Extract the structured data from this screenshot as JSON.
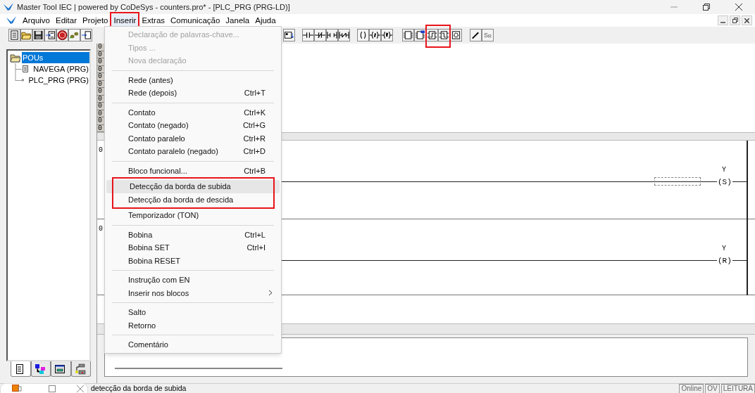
{
  "window": {
    "title": "Master Tool IEC | powered by CoDeSys - counters.pro* - [PLC_PRG (PRG-LD)]"
  },
  "menu_bar": [
    {
      "label": "Arquivo",
      "selected": false,
      "highlighted": false
    },
    {
      "label": "Editar",
      "selected": false,
      "highlighted": false
    },
    {
      "label": "Projeto",
      "selected": false,
      "highlighted": false
    },
    {
      "label": "Inserir",
      "selected": true,
      "highlighted": true
    },
    {
      "label": "Extras",
      "selected": false,
      "highlighted": false
    },
    {
      "label": "Comunicação",
      "selected": false,
      "highlighted": false
    },
    {
      "label": "Janela",
      "selected": false,
      "highlighted": false
    },
    {
      "label": "Ajuda",
      "selected": false,
      "highlighted": false
    }
  ],
  "toolbar": [
    [
      {
        "kind": "new",
        "highlighted": false
      },
      {
        "kind": "open",
        "highlighted": false
      },
      {
        "kind": "save",
        "highlighted": false
      }
    ],
    [
      {
        "kind": "download",
        "highlighted": false
      },
      {
        "kind": "stop",
        "highlighted": false
      },
      {
        "kind": "step",
        "highlighted": false
      },
      {
        "kind": "upload",
        "highlighted": false
      }
    ],
    [
      {
        "kind": "network",
        "highlighted": false
      }
    ],
    [
      {
        "kind": "contact",
        "highlighted": false
      },
      {
        "kind": "contact-negated",
        "highlighted": false
      },
      {
        "kind": "contact-parallel",
        "highlighted": false
      },
      {
        "kind": "contact-parallel-negated",
        "highlighted": false
      }
    ],
    [
      {
        "kind": "coil",
        "highlighted": false
      },
      {
        "kind": "coil-set",
        "highlighted": false
      },
      {
        "kind": "coil-reset",
        "highlighted": false
      }
    ],
    [
      {
        "kind": "block",
        "highlighted": false
      },
      {
        "kind": "block-marked",
        "highlighted": false
      },
      {
        "kind": "edge-rising",
        "highlighted": true
      },
      {
        "kind": "edge-falling",
        "highlighted": true
      },
      {
        "kind": "block-gear",
        "highlighted": false
      }
    ],
    [
      {
        "kind": "pencil",
        "highlighted": false
      },
      {
        "kind": "set-reset",
        "label": "S$_{R}$",
        "highlighted": false
      }
    ]
  ],
  "insert_menu": [
    [
      {
        "label": "Declaração de palavras-chave...",
        "disabled": true,
        "selected": false,
        "highlighted": false
      },
      {
        "label": "Tipos ...",
        "disabled": true,
        "selected": false,
        "highlighted": false
      },
      {
        "label": "Nova declaração",
        "disabled": true,
        "selected": false,
        "highlighted": false
      }
    ],
    [
      {
        "label": "Rede (antes)",
        "disabled": false,
        "selected": false,
        "highlighted": false
      },
      {
        "label": "Rede (depois)",
        "shortcut": "Ctrl+T",
        "disabled": false,
        "selected": false,
        "highlighted": false
      }
    ],
    [
      {
        "label": "Contato",
        "shortcut": "Ctrl+K",
        "disabled": false,
        "selected": false,
        "highlighted": false
      },
      {
        "label": "Contato (negado)",
        "shortcut": "Ctrl+G",
        "disabled": false,
        "selected": false,
        "highlighted": false
      },
      {
        "label": "Contato paralelo",
        "shortcut": "Ctrl+R",
        "disabled": false,
        "selected": false,
        "highlighted": false
      },
      {
        "label": "Contato paralelo (negado)",
        "shortcut": "Ctrl+D",
        "disabled": false,
        "selected": false,
        "highlighted": false
      }
    ],
    [
      {
        "label": "Bloco funcional...",
        "shortcut": "Ctrl+B",
        "disabled": false,
        "selected": false,
        "highlighted": false
      },
      {
        "label": "Detecção da borda de subida",
        "disabled": false,
        "selected": true,
        "highlighted": true
      },
      {
        "label": "Detecção da borda de descida",
        "disabled": false,
        "selected": false,
        "highlighted": true
      },
      {
        "label": "Temporizador (TON)",
        "disabled": false,
        "selected": false,
        "highlighted": false
      }
    ],
    [
      {
        "label": "Bobina",
        "shortcut": "Ctrl+L",
        "disabled": false,
        "selected": false,
        "highlighted": false
      },
      {
        "label": "Bobina SET",
        "shortcut": "Ctrl+I",
        "disabled": false,
        "selected": false,
        "highlighted": false
      },
      {
        "label": "Bobina RESET",
        "disabled": false,
        "selected": false,
        "highlighted": false
      }
    ],
    [
      {
        "label": "Instrução com EN",
        "disabled": false,
        "selected": false,
        "highlighted": false
      },
      {
        "label": "Inserir nos blocos",
        "submenu": true,
        "disabled": false,
        "selected": false,
        "highlighted": false
      }
    ],
    [
      {
        "label": "Salto",
        "disabled": false,
        "selected": false,
        "highlighted": false
      },
      {
        "label": "Retorno",
        "disabled": false,
        "selected": false,
        "highlighted": false
      }
    ],
    [
      {
        "label": "Comentário",
        "disabled": false,
        "selected": false,
        "highlighted": false
      }
    ]
  ],
  "object_tree": [
    {
      "label": "POUs",
      "selected": true,
      "expanded": true,
      "children": [
        {
          "label": "NAVEGA (PRG)",
          "kind": "text",
          "selected": false
        },
        {
          "label": "PLC_PRG (PRG)",
          "kind": "ladder",
          "selected": false
        }
      ]
    }
  ],
  "object_tabs": [
    {
      "kind": "pous",
      "selected": true
    },
    {
      "kind": "types",
      "selected": false
    },
    {
      "kind": "visualizations",
      "selected": false
    },
    {
      "kind": "resources",
      "selected": false
    }
  ],
  "declaration_line_numbers": [
    "0",
    "0",
    "0",
    "0",
    "0",
    "0",
    "0",
    "0",
    "0",
    "0",
    "0",
    "0"
  ],
  "networks": [
    {
      "number": "0",
      "variable": "Y",
      "coil": "(S)",
      "selection": true
    },
    {
      "number": "0",
      "variable": "Y",
      "coil": "(R)",
      "selection": false
    }
  ],
  "status_bar": {
    "message": "detecção da borda de subida",
    "indicators": [
      "Online",
      "OV",
      "LEITURA"
    ]
  }
}
